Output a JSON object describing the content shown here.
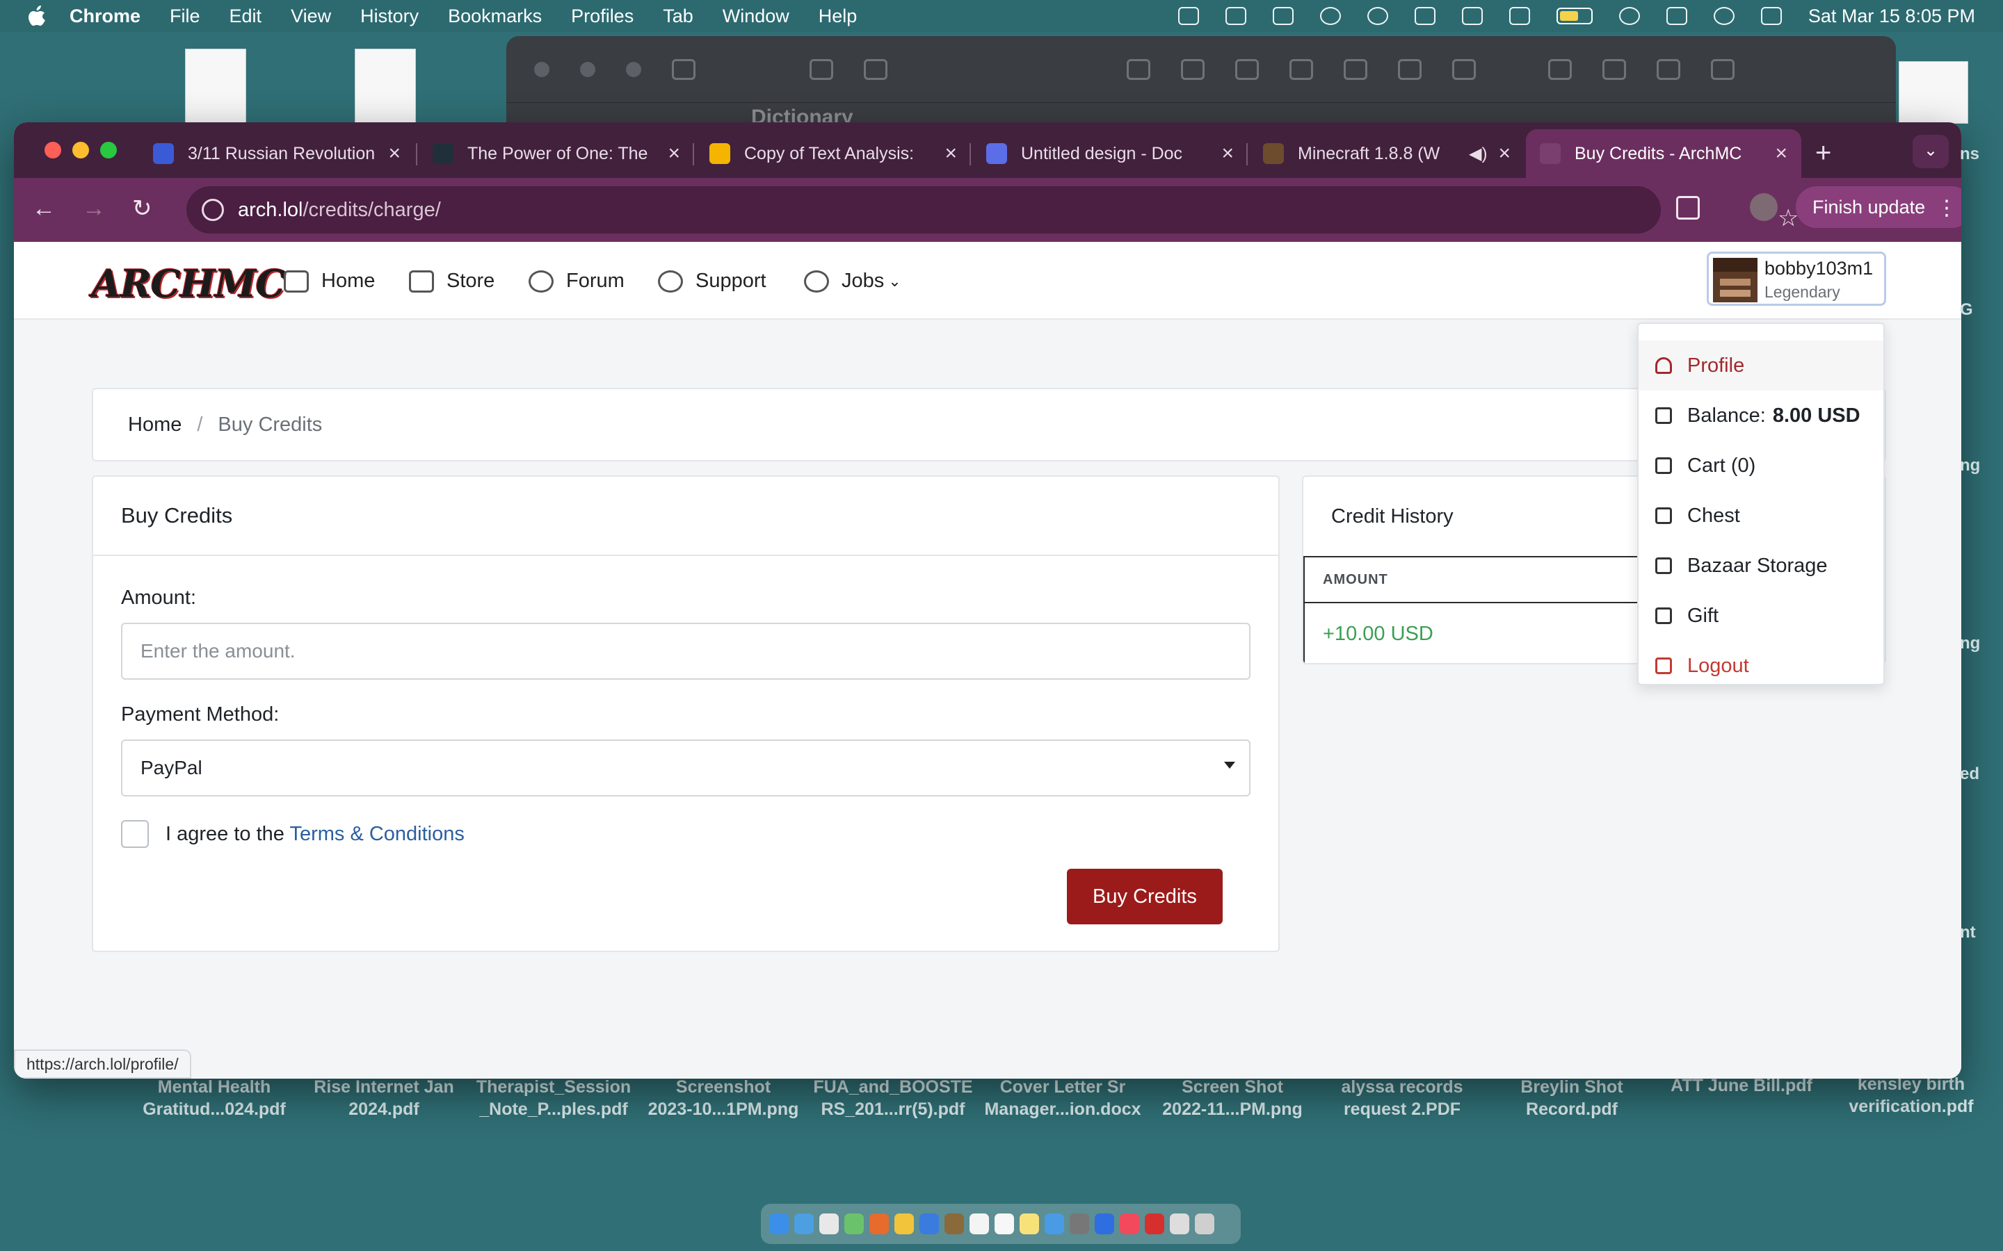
{
  "menubar": {
    "app": "Chrome",
    "items": [
      "File",
      "Edit",
      "View",
      "History",
      "Bookmarks",
      "Profiles",
      "Tab",
      "Window",
      "Help"
    ],
    "clock": "Sat Mar 15  8:05 PM"
  },
  "tabs": [
    {
      "title": "3/11 Russian Revolution",
      "icon_color": "#3b5bd6",
      "active": false
    },
    {
      "title": "The Power of One: The",
      "icon_color": "#20303a",
      "active": false
    },
    {
      "title": "Copy of Text Analysis:",
      "icon_color": "#f4b400",
      "active": false
    },
    {
      "title": "Untitled design - Doc",
      "icon_color": "#5b6ee8",
      "active": false
    },
    {
      "title": "Minecraft 1.8.8 (W",
      "icon_color": "#6d4c2e",
      "active": false
    },
    {
      "title": "Buy Credits - ArchMC",
      "icon_color": "#7a3f6e",
      "active": true
    }
  ],
  "toolbar": {
    "url_host": "arch.lol",
    "url_path": "/credits/charge/",
    "finish_update": "Finish update"
  },
  "site": {
    "logo": "ARCHMC",
    "nav": {
      "home": "Home",
      "store": "Store",
      "forum": "Forum",
      "support": "Support",
      "jobs": "Jobs"
    },
    "user": {
      "name": "bobby103m1",
      "rank": "Legendary"
    }
  },
  "breadcrumb": {
    "home": "Home",
    "sep": "/",
    "current": "Buy Credits"
  },
  "buy": {
    "title": "Buy Credits",
    "amount_label": "Amount:",
    "amount_placeholder": "Enter the amount.",
    "amount_value": "",
    "payment_label": "Payment Method:",
    "payment_selected": "PayPal",
    "agree_prefix": "I agree to the",
    "agree_link": "Terms & Conditions",
    "agree_checked": false,
    "submit": "Buy Credits"
  },
  "history": {
    "title": "Credit History",
    "columns": [
      "AMOUNT"
    ],
    "rows": [
      {
        "amount": "+10.00 USD"
      }
    ]
  },
  "dropdown": {
    "profile": "Profile",
    "balance_label": "Balance:",
    "balance_value": "8.00 USD",
    "cart": "Cart (0)",
    "chest": "Chest",
    "bazaar": "Bazaar Storage",
    "gift": "Gift",
    "logout": "Logout"
  },
  "status_url": "https://arch.lol/profile/",
  "desktop": {
    "files": [
      {
        "line1": "Mental Health",
        "line2": "Gratitud...024.pdf"
      },
      {
        "line1": "Rise Internet Jan",
        "line2": "2024.pdf"
      },
      {
        "line1": "Therapist_Session",
        "line2": "_Note_P...ples.pdf"
      },
      {
        "line1": "Screenshot",
        "line2": "2023-10...1PM.png"
      },
      {
        "line1": "FUA_and_BOOSTE",
        "line2": "RS_201...rr(5).pdf"
      },
      {
        "line1": "Cover Letter Sr",
        "line2": "Manager...ion.docx"
      },
      {
        "line1": "Screen Shot",
        "line2": "2022-11...PM.png"
      },
      {
        "line1": "alyssa records",
        "line2": "request 2.PDF"
      },
      {
        "line1": "Breylin Shot",
        "line2": "Record.pdf"
      },
      {
        "line1": "ATT June Bill.pdf",
        "line2": ""
      },
      {
        "line1": "kensley birth",
        "line2": "verification.pdf"
      }
    ],
    "bg_window_title": "Dictionary"
  },
  "colors": {
    "brand_red": "#9b1b1b",
    "link_blue": "#2c5e9e",
    "credit_green": "#3aa053",
    "chrome_frame": "#6b2f5f"
  }
}
